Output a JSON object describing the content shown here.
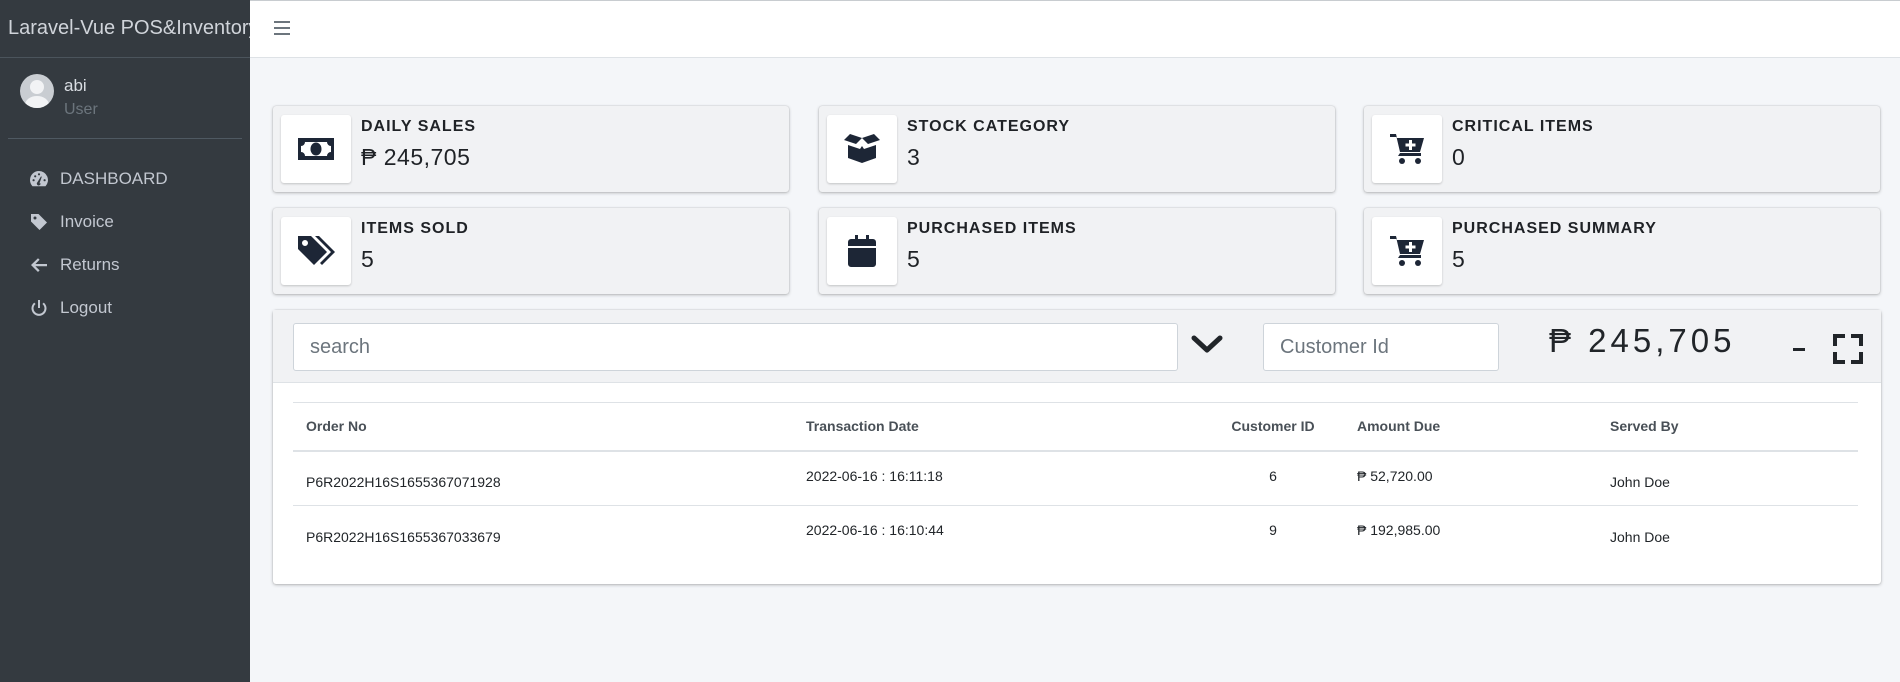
{
  "app": {
    "title": "Laravel-Vue POS&Inventory"
  },
  "user": {
    "name": "abi",
    "role": "User"
  },
  "nav": [
    {
      "label": "DASHBOARD",
      "icon": "tachometer-icon"
    },
    {
      "label": "Invoice",
      "icon": "tag-icon"
    },
    {
      "label": "Returns",
      "icon": "arrow-left-icon"
    },
    {
      "label": "Logout",
      "icon": "power-icon"
    }
  ],
  "stats": [
    {
      "label": "DAILY SALES",
      "value": "₱ 245,705",
      "icon": "money-bill-icon"
    },
    {
      "label": "STOCK CATEGORY",
      "value": "3",
      "icon": "box-open-icon"
    },
    {
      "label": "CRITICAL ITEMS",
      "value": "0",
      "icon": "cart-plus-icon"
    },
    {
      "label": "ITEMS SOLD",
      "value": "5",
      "icon": "tags-icon"
    },
    {
      "label": "PURCHASED ITEMS",
      "value": "5",
      "icon": "calendar-icon"
    },
    {
      "label": "PURCHASED SUMMARY",
      "value": "5",
      "icon": "cart-plus-icon"
    }
  ],
  "toolbar": {
    "search_placeholder": "search",
    "customer_placeholder": "Customer Id",
    "total": "₱ 245,705"
  },
  "table": {
    "headers": [
      "Order No",
      "Transaction Date",
      "Customer ID",
      "Amount Due",
      "Served By"
    ],
    "rows": [
      [
        "P6R2022H16S1655367071928",
        "2022-06-16 : 16:11:18",
        "6",
        "₱ 52,720.00",
        "John Doe"
      ],
      [
        "P6R2022H16S1655367033679",
        "2022-06-16 : 16:10:44",
        "9",
        "₱ 192,985.00",
        "John Doe"
      ]
    ]
  },
  "colors": {
    "sidebar": "#343a40",
    "background": "#f4f6f9",
    "icon": "#1d2636"
  }
}
